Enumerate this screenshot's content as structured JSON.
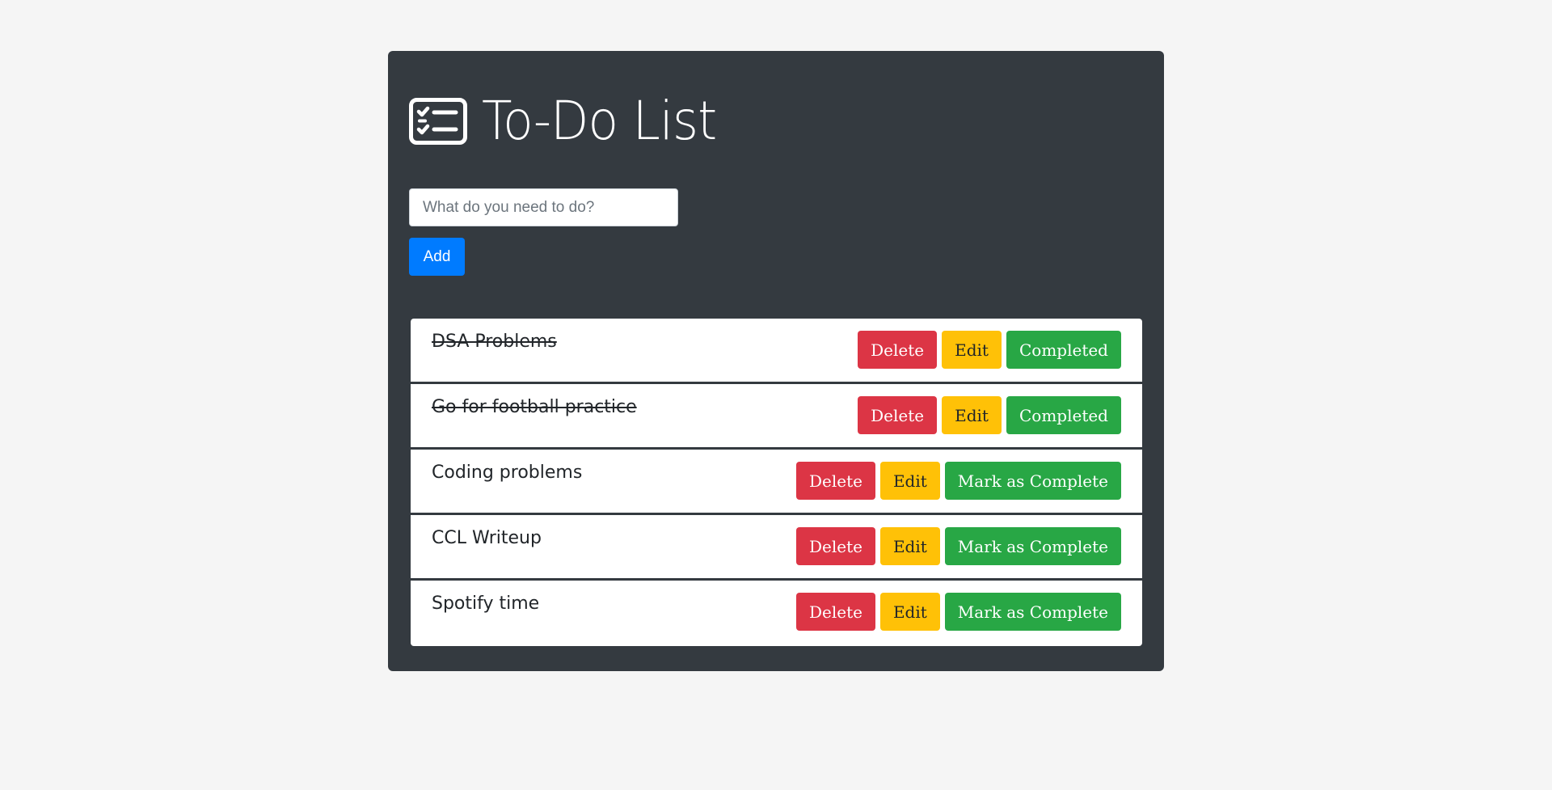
{
  "header": {
    "icon": "checklist-icon",
    "title": "To-Do List"
  },
  "form": {
    "placeholder": "What do you need to do?",
    "value": "",
    "add_label": "Add"
  },
  "colors": {
    "card_bg": "#343a40",
    "page_bg": "#f5f5f5",
    "primary": "#007bff",
    "danger": "#dc3545",
    "warning": "#ffc107",
    "success": "#28a745"
  },
  "tasks": [
    {
      "text": "DSA Problems",
      "completed": true,
      "delete_label": "Delete",
      "edit_label": "Edit",
      "status_label": "Completed"
    },
    {
      "text": "Go for football practice",
      "completed": true,
      "delete_label": "Delete",
      "edit_label": "Edit",
      "status_label": "Completed"
    },
    {
      "text": "Coding problems",
      "completed": false,
      "delete_label": "Delete",
      "edit_label": "Edit",
      "status_label": "Mark as Complete"
    },
    {
      "text": "CCL Writeup",
      "completed": false,
      "delete_label": "Delete",
      "edit_label": "Edit",
      "status_label": "Mark as Complete"
    },
    {
      "text": "Spotify time",
      "completed": false,
      "delete_label": "Delete",
      "edit_label": "Edit",
      "status_label": "Mark as Complete"
    }
  ]
}
